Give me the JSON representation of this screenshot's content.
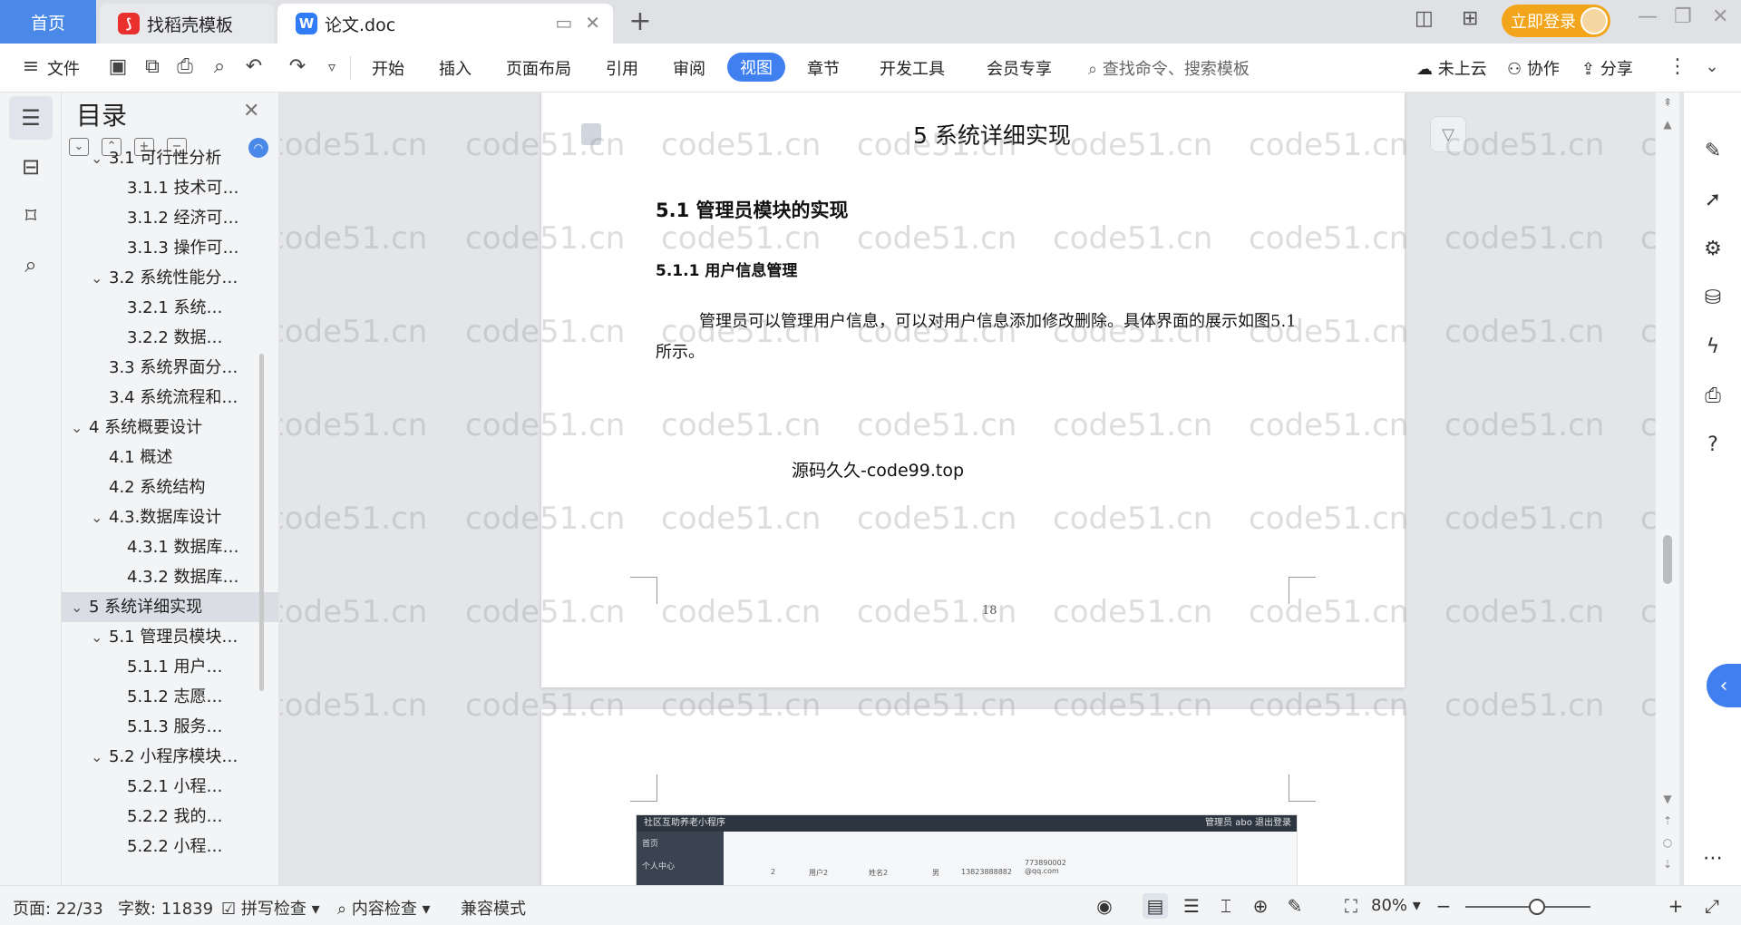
{
  "tabs": {
    "home": "首页",
    "daoke": "找稻壳模板",
    "doc": "论文.doc",
    "new_tab": "+"
  },
  "titlebar": {
    "login": "立即登录"
  },
  "ribbon": {
    "file": "文件",
    "menus": [
      "开始",
      "插入",
      "页面布局",
      "引用",
      "审阅",
      "视图",
      "章节",
      "开发工具",
      "会员专享"
    ],
    "active": "视图",
    "search_placeholder": "查找命令、搜索模板",
    "cloud": "未上云",
    "collab": "协作",
    "share": "分享"
  },
  "toc": {
    "title": "目录",
    "items": [
      {
        "label": "3.1 可行性分析",
        "level": 2,
        "expanded": true
      },
      {
        "label": "3.1.1 技术可…",
        "level": 3
      },
      {
        "label": "3.1.2 经济可…",
        "level": 3
      },
      {
        "label": "3.1.3 操作可…",
        "level": 3
      },
      {
        "label": "3.2 系统性能分…",
        "level": 2,
        "expanded": true
      },
      {
        "label": "3.2.1  系统…",
        "level": 3
      },
      {
        "label": "3.2.2  数据…",
        "level": 3
      },
      {
        "label": "3.3 系统界面分…",
        "level": 2
      },
      {
        "label": "3.4 系统流程和…",
        "level": 2
      },
      {
        "label": "4 系统概要设计",
        "level": 1,
        "expanded": true
      },
      {
        "label": "4.1 概述",
        "level": 2
      },
      {
        "label": "4.2 系统结构",
        "level": 2
      },
      {
        "label": "4.3.数据库设计",
        "level": 2,
        "expanded": true
      },
      {
        "label": "4.3.1 数据库…",
        "level": 3
      },
      {
        "label": "4.3.2 数据库…",
        "level": 3
      },
      {
        "label": "5 系统详细实现",
        "level": 1,
        "expanded": true,
        "selected": true
      },
      {
        "label": "5.1  管理员模块…",
        "level": 2,
        "expanded": true
      },
      {
        "label": "5.1.1  用户…",
        "level": 3
      },
      {
        "label": "5.1.2  志愿…",
        "level": 3
      },
      {
        "label": "5.1.3  服务…",
        "level": 3
      },
      {
        "label": "5.2  小程序模块…",
        "level": 2,
        "expanded": true
      },
      {
        "label": "5.2.1  小程…",
        "level": 3
      },
      {
        "label": "5.2.2  我的…",
        "level": 3
      },
      {
        "label": "5.2.2  小程…",
        "level": 3
      }
    ]
  },
  "document": {
    "chapter_heading": "5 系统详细实现",
    "section_heading": "5.1  管理员模块的实现",
    "subsection_heading": "5.1.1  用户信息管理",
    "paragraph": "管理员可以管理用户信息，可以对用户信息添加修改删除。具体界面的展示如图5.1 所示。",
    "source_note": "源码久久-code99.top",
    "page_number": "18",
    "watermark": "code51.cn",
    "embedded_screenshot": {
      "title": "社区互助养老小程序",
      "top_right": "管理员 abo    退出登录",
      "menu": [
        "首页",
        "个人中心"
      ],
      "row": [
        "2",
        "用户2",
        "姓名2",
        "男",
        "13823888882",
        "773890002@qq.com"
      ]
    }
  },
  "status": {
    "page": "页面: 22/33",
    "words": "字数: 11839",
    "spell": "拼写检查",
    "content_check": "内容检查",
    "compat": "兼容模式",
    "zoom": "80%"
  }
}
